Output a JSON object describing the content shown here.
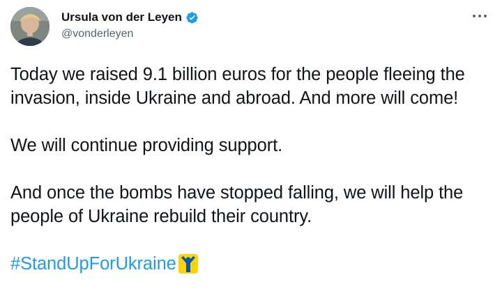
{
  "author": {
    "display_name": "Ursula von der Leyen",
    "handle": "@vonderleyen",
    "verified": true,
    "verified_color": "#1d9bf0"
  },
  "tweet": {
    "paragraph1": "Today we raised 9.1 billion euros for the people fleeing the invasion, inside Ukraine and abroad. And more will come!",
    "paragraph2": "We will continue providing support.",
    "paragraph3": "And once the bombs have stopped falling, we will help the people of Ukraine rebuild their country.",
    "hashtag": "#StandUpForUkraine",
    "hashtag_color": "#1d9bf0",
    "emoji": "standup-for-ukraine-emoji"
  },
  "menu": {
    "icon": "more-options-icon"
  }
}
